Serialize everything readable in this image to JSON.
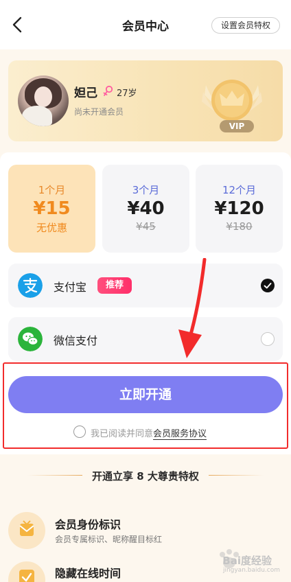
{
  "header": {
    "title": "会员中心",
    "set_privilege_label": "设置会员特权"
  },
  "profile": {
    "name": "妲己",
    "age": "27岁",
    "status": "尚未开通会员",
    "vip_label": "VIP"
  },
  "plans": [
    {
      "duration": "1个月",
      "price": "¥15",
      "note": "无优惠",
      "selected": true
    },
    {
      "duration": "3个月",
      "price": "¥40",
      "original": "¥45",
      "selected": false
    },
    {
      "duration": "12个月",
      "price": "¥120",
      "original": "¥180",
      "selected": false
    }
  ],
  "payment": {
    "alipay_label": "支付宝",
    "recommend_badge": "推荐",
    "wechat_label": "微信支付",
    "alipay_icon": "alipay-icon",
    "wechat_icon": "wechat-pay-icon"
  },
  "action": {
    "open_label": "立即开通",
    "agree_prefix": "我已阅读并同意",
    "agree_link": "会员服务协议"
  },
  "privileges": {
    "title": "开通立享 8 大尊贵特权",
    "items": [
      {
        "name": "会员身份标识",
        "desc": "会员专属标识、昵称醒目标红",
        "icon": "member-badge-icon"
      },
      {
        "name": "隐藏在线时间",
        "desc": "",
        "icon": "checkbox-icon"
      }
    ]
  },
  "watermark": {
    "text": "Bai度经验",
    "sub": "jingyan.baidu.com"
  },
  "colors": {
    "primary_button": "#7f7ef2",
    "selected_plan_bg": "#fde3b8",
    "accent_orange": "#f08a1e",
    "recommend_pink": "#ff3a70",
    "annotation_red": "#f22b2b"
  }
}
